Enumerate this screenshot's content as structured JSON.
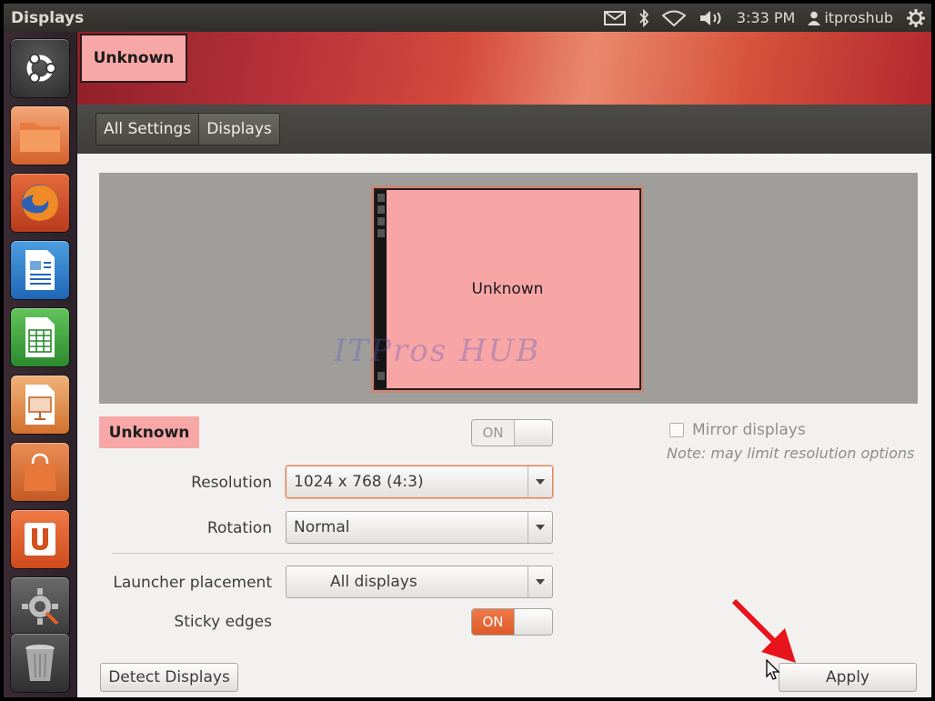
{
  "window": {
    "title": "Displays"
  },
  "panel": {
    "time": "3:33 PM",
    "user": "itproshub",
    "icons": [
      "mail-icon",
      "bluetooth-icon",
      "wifi-icon",
      "volume-icon",
      "user-icon",
      "gear-icon"
    ]
  },
  "launcher": {
    "items": [
      "ubuntu-dash",
      "files",
      "firefox",
      "libreoffice-writer",
      "libreoffice-calc",
      "libreoffice-impress",
      "software-center",
      "ubuntu-one",
      "system-settings",
      "trash"
    ]
  },
  "header": {
    "display_label": "Unknown"
  },
  "breadcrumbs": [
    "All Settings",
    "Displays"
  ],
  "preview": {
    "monitor_label": "Unknown",
    "watermark": "ITPros HUB"
  },
  "display": {
    "name": "Unknown",
    "power_switch": "ON",
    "power_on": false
  },
  "resolution": {
    "label": "Resolution",
    "value": "1024 x 768 (4:3)"
  },
  "rotation": {
    "label": "Rotation",
    "value": "Normal"
  },
  "launcher_placement": {
    "label": "Launcher placement",
    "value": "All displays"
  },
  "sticky_edges": {
    "label": "Sticky edges",
    "switch": "ON",
    "on": true
  },
  "mirror": {
    "label": "Mirror displays",
    "checked": false,
    "note": "Note: may limit resolution options"
  },
  "buttons": {
    "detect": "Detect Displays",
    "apply": "Apply"
  },
  "colors": {
    "accent": "#dd5a2a",
    "display_highlight": "#f7a7a6",
    "annotation_arrow": "#e8141b"
  }
}
